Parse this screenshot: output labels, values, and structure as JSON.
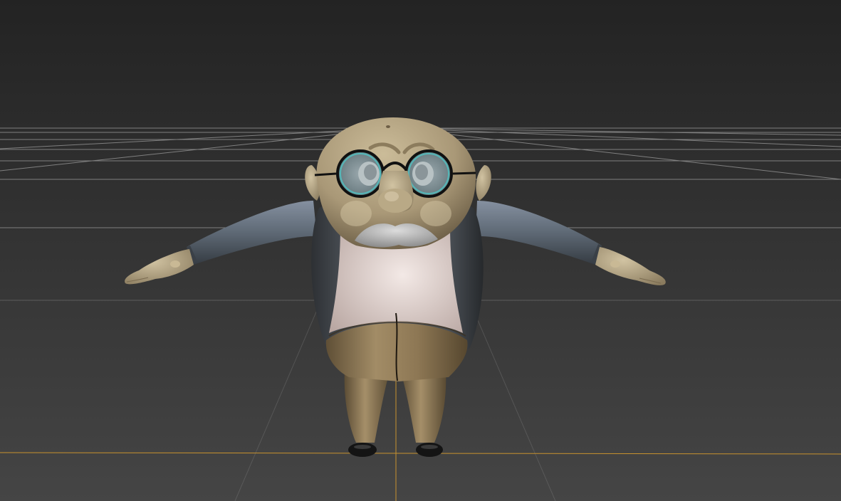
{
  "viewport": {
    "background_top": "#232323",
    "background_bottom": "#444444",
    "grid_color": "#9a9a9a",
    "axis_color": "#c8922e"
  },
  "model": {
    "kind": "3d-character",
    "pose": "t-pose",
    "colors": {
      "skin": "#bfae8a",
      "vest": "#3d4146",
      "sleeve": "#6b7682",
      "shirt": "#e7d7d3",
      "trousers": "#8a7552",
      "mustache": "#b8b8b8",
      "glasses_frame": "#111111",
      "glasses_lens": "#8fd6d6",
      "shoes": "#151515"
    }
  }
}
